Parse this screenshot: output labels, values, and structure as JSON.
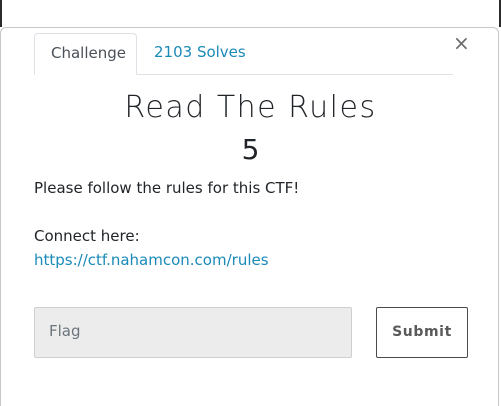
{
  "modal": {
    "tabs": [
      {
        "label": "Challenge",
        "active": true
      },
      {
        "label": "2103 Solves",
        "active": false
      }
    ],
    "close_glyph": "×",
    "challenge": {
      "title": "Read The Rules",
      "value": "5",
      "description_line1": "Please follow the rules for this CTF!",
      "description_line2": "Connect here:",
      "link_text": "https://ctf.nahamcon.com/rules"
    },
    "flag_input": {
      "placeholder": "Flag",
      "value": ""
    },
    "submit_label": "Submit"
  },
  "colors": {
    "link": "#1a8ab9",
    "text": "#212529",
    "input_bg": "#ececec"
  }
}
